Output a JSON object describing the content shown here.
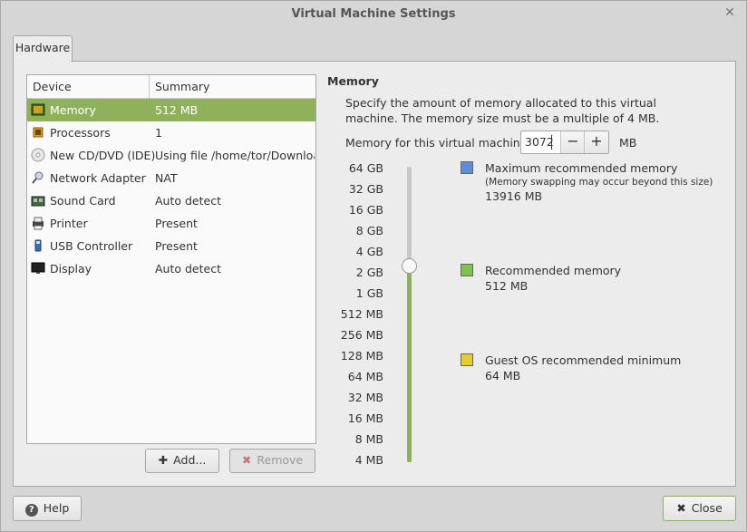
{
  "window": {
    "title": "Virtual Machine Settings"
  },
  "tabs": [
    {
      "label": "Hardware"
    }
  ],
  "device_list": {
    "headers": {
      "device": "Device",
      "summary": "Summary"
    },
    "rows": [
      {
        "icon": "memory-chip-icon",
        "name": "Memory",
        "summary": "512 MB",
        "selected": true
      },
      {
        "icon": "processor-icon",
        "name": "Processors",
        "summary": "1"
      },
      {
        "icon": "cd-dvd-icon",
        "name": "New CD/DVD (IDE)",
        "summary": "Using file /home/tor/Downloads/"
      },
      {
        "icon": "network-adapter-icon",
        "name": "Network Adapter",
        "summary": "NAT"
      },
      {
        "icon": "sound-card-icon",
        "name": "Sound Card",
        "summary": "Auto detect"
      },
      {
        "icon": "printer-icon",
        "name": "Printer",
        "summary": "Present"
      },
      {
        "icon": "usb-controller-icon",
        "name": "USB Controller",
        "summary": "Present"
      },
      {
        "icon": "display-icon",
        "name": "Display",
        "summary": "Auto detect"
      }
    ]
  },
  "buttons": {
    "add": "Add...",
    "remove": "Remove",
    "help": "Help",
    "close": "Close"
  },
  "memory": {
    "title": "Memory",
    "description": "Specify the amount of memory allocated to this virtual machine. The memory size must be a multiple of 4 MB.",
    "field_label": "Memory for this virtual machine:",
    "value": "3072",
    "unit": "MB",
    "scale": [
      "64 GB",
      "32 GB",
      "16 GB",
      "8 GB",
      "4 GB",
      "2 GB",
      "1 GB",
      "512 MB",
      "256 MB",
      "128 MB",
      "64 MB",
      "32 MB",
      "16 MB",
      "8 MB",
      "4 MB"
    ],
    "slider_level_fraction": 0.67,
    "legend": {
      "max": {
        "title": "Maximum recommended memory",
        "note": "(Memory swapping may occur beyond this size)",
        "value": "13916 MB",
        "color": "#5b8fd1"
      },
      "recommended": {
        "title": "Recommended memory",
        "value": "512 MB",
        "color": "#7fc24a"
      },
      "minimum": {
        "title": "Guest OS recommended minimum",
        "value": "64 MB",
        "color": "#e6cc2e"
      }
    }
  },
  "colors": {
    "selection": "#8fb15c",
    "slider_fill": "#8fb15c"
  }
}
